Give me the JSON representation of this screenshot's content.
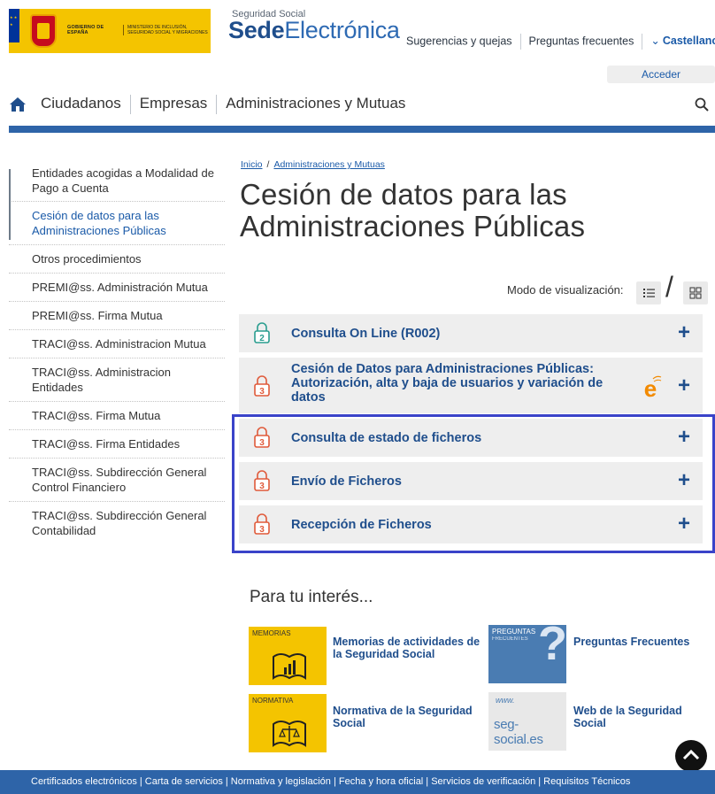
{
  "header": {
    "gov_line1": "GOBIERNO DE ESPAÑA",
    "gov_line2": "MINISTERIO DE INCLUSIÓN, SEGURIDAD SOCIAL Y MIGRACIONES",
    "site_small": "Seguridad Social",
    "site_bold": "Sede",
    "site_thin": "Electrónica",
    "links": [
      "Sugerencias y quejas",
      "Preguntas frecuentes"
    ],
    "language": "Castellano",
    "login": "Acceder"
  },
  "nav": {
    "items": [
      "Ciudadanos",
      "Empresas",
      "Administraciones y Mutuas"
    ]
  },
  "sidebar": {
    "items": [
      {
        "label": "Entidades acogidas a Modalidad de Pago a Cuenta"
      },
      {
        "label": "Cesión de datos para las Administraciones Públicas"
      },
      {
        "label": "Otros procedimientos"
      },
      {
        "label": "PREMI@ss. Administración Mutua"
      },
      {
        "label": "PREMI@ss. Firma Mutua"
      },
      {
        "label": "TRACI@ss. Administracion Mutua"
      },
      {
        "label": "TRACI@ss. Administracion Entidades"
      },
      {
        "label": "TRACI@ss. Firma Mutua"
      },
      {
        "label": "TRACI@ss. Firma Entidades"
      },
      {
        "label": "TRACI@ss. Subdirección General Control Financiero"
      },
      {
        "label": "TRACI@ss. Subdirección General Contabilidad"
      }
    ]
  },
  "breadcrumb": {
    "home": "Inicio",
    "section": "Administraciones y Mutuas"
  },
  "page": {
    "title": "Cesión de datos para las Administraciones Públicas"
  },
  "view": {
    "label": "Modo de visualización:"
  },
  "procedures": [
    {
      "label": "Consulta On Line (R002)",
      "level": "2"
    },
    {
      "label": "Cesión de Datos para Administraciones Públicas: Autorización, alta y baja de usuarios y variación de datos",
      "level": "3"
    },
    {
      "label": "Consulta de estado de ficheros",
      "level": "3"
    },
    {
      "label": "Envío de Ficheros",
      "level": "3"
    },
    {
      "label": "Recepción de Ficheros",
      "level": "3"
    }
  ],
  "interest": {
    "title": "Para tu interés...",
    "tiles": [
      {
        "tag": "MEMORIAS",
        "text": "Memorias de actividades de la Seguridad Social"
      },
      {
        "tag": "PREGUNTAS",
        "tag2": "FRECUENTES",
        "text": "Preguntas Frecuentes"
      },
      {
        "tag": "NORMATIVA",
        "text": "Normativa de la Seguridad Social"
      },
      {
        "tag": "seg-social.es",
        "text": "Web de la Seguridad Social"
      }
    ]
  },
  "footer": {
    "text": "Certificados electrónicos | Carta de servicios | Normativa y legislación | Fecha y hora oficial | Servicios de verificación | Requisitos Técnicos"
  },
  "colors": {
    "brand_blue": "#2e64a8",
    "link_blue": "#1f4e8c",
    "gov_yellow": "#f4c400",
    "highlight": "#3a43c9"
  }
}
